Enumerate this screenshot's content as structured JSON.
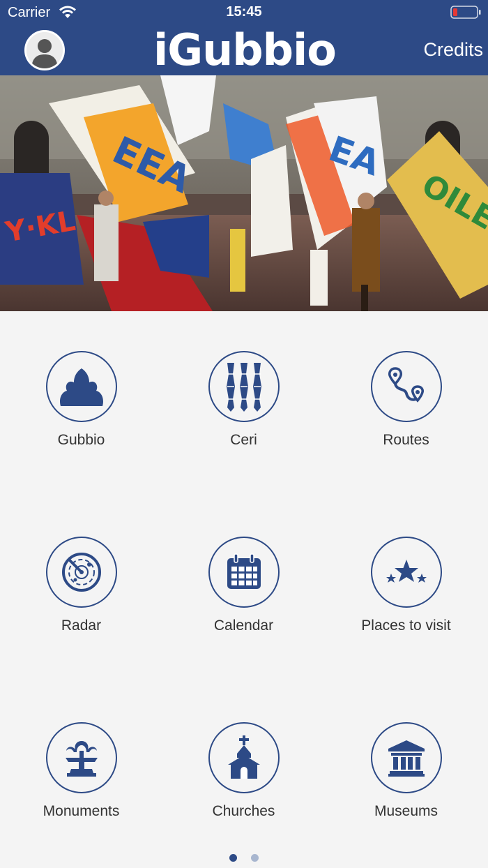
{
  "status": {
    "carrier": "Carrier",
    "time": "15:45"
  },
  "header": {
    "logo": "iGubbio",
    "credits": "Credits"
  },
  "hero": {
    "alt": "Flag-throwers in the piazza"
  },
  "menu": [
    {
      "label": "Gubbio",
      "icon": "gubbio-crest-icon"
    },
    {
      "label": "Ceri",
      "icon": "ceri-icon"
    },
    {
      "label": "Routes",
      "icon": "route-icon"
    },
    {
      "label": "Radar",
      "icon": "radar-icon"
    },
    {
      "label": "Calendar",
      "icon": "calendar-icon"
    },
    {
      "label": "Places to visit",
      "icon": "stars-icon"
    },
    {
      "label": "Monuments",
      "icon": "fountain-icon"
    },
    {
      "label": "Churches",
      "icon": "church-icon"
    },
    {
      "label": "Museums",
      "icon": "museum-icon"
    }
  ],
  "pager": {
    "pages": 2,
    "current": 1
  },
  "colors": {
    "brand": "#2d4a86",
    "background": "#f4f4f4",
    "dot_active": "#2d4a86",
    "dot_inactive": "#a8b6cf"
  }
}
